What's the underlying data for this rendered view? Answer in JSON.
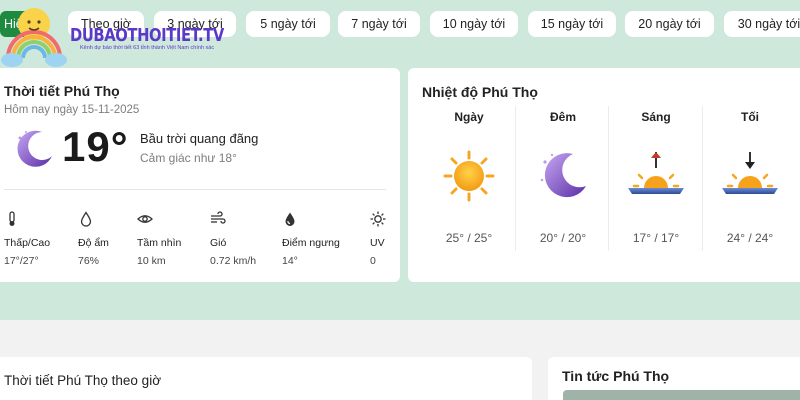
{
  "tabs": [
    {
      "label": "Hiện tại",
      "active": true
    },
    {
      "label": "Theo giờ"
    },
    {
      "label": "3 ngày tới"
    },
    {
      "label": "5 ngày tới"
    },
    {
      "label": "7 ngày tới"
    },
    {
      "label": "10 ngày tới"
    },
    {
      "label": "15 ngày tới"
    },
    {
      "label": "20 ngày tới"
    },
    {
      "label": "30 ngày tới"
    }
  ],
  "logo": {
    "text": "DUBAOTHOITIET.TV",
    "tagline": "Kênh dự báo thời tiết 63 tỉnh thành Việt Nam chính xác"
  },
  "current": {
    "title": "Thời tiết Phú Thọ",
    "date": "Hôm nay ngày 15-11-2025",
    "temp": "19°",
    "condition": "Bầu trời quang đãng",
    "feels_like": "Cảm giác như 18°",
    "icon": "moon-stars-icon",
    "stats": [
      {
        "icon": "thermometer-icon",
        "label": "Thấp/Cao",
        "value": "17°/27°"
      },
      {
        "icon": "droplet-icon",
        "label": "Độ ẩm",
        "value": "76%"
      },
      {
        "icon": "eye-icon",
        "label": "Tầm nhìn",
        "value": "10 km"
      },
      {
        "icon": "wind-icon",
        "label": "Gió",
        "value": "0.72 km/h"
      },
      {
        "icon": "dew-point-icon",
        "label": "Điểm ngưng",
        "value": "14°"
      },
      {
        "icon": "sun-uv-icon",
        "label": "UV",
        "value": "0"
      }
    ]
  },
  "temps": {
    "title": "Nhiệt độ Phú Thọ",
    "periods": [
      {
        "name": "Ngày",
        "icon": "sun-icon",
        "temp": "25° / 25°"
      },
      {
        "name": "Đêm",
        "icon": "moon-icon",
        "temp": "20° / 20°"
      },
      {
        "name": "Sáng",
        "icon": "sunrise-icon",
        "temp": "17° / 17°"
      },
      {
        "name": "Tối",
        "icon": "sunset-icon",
        "temp": "24° / 24°"
      }
    ]
  },
  "hourly": {
    "title": "Thời tiết Phú Thọ theo giờ"
  },
  "news": {
    "title": "Tin tức Phú Thọ"
  },
  "colors": {
    "accent": "#1e8a3f",
    "background": "#cfe8dc",
    "logo": "#5a39c8",
    "sun": "#f7a21b",
    "moon": "#7b4fc9"
  }
}
